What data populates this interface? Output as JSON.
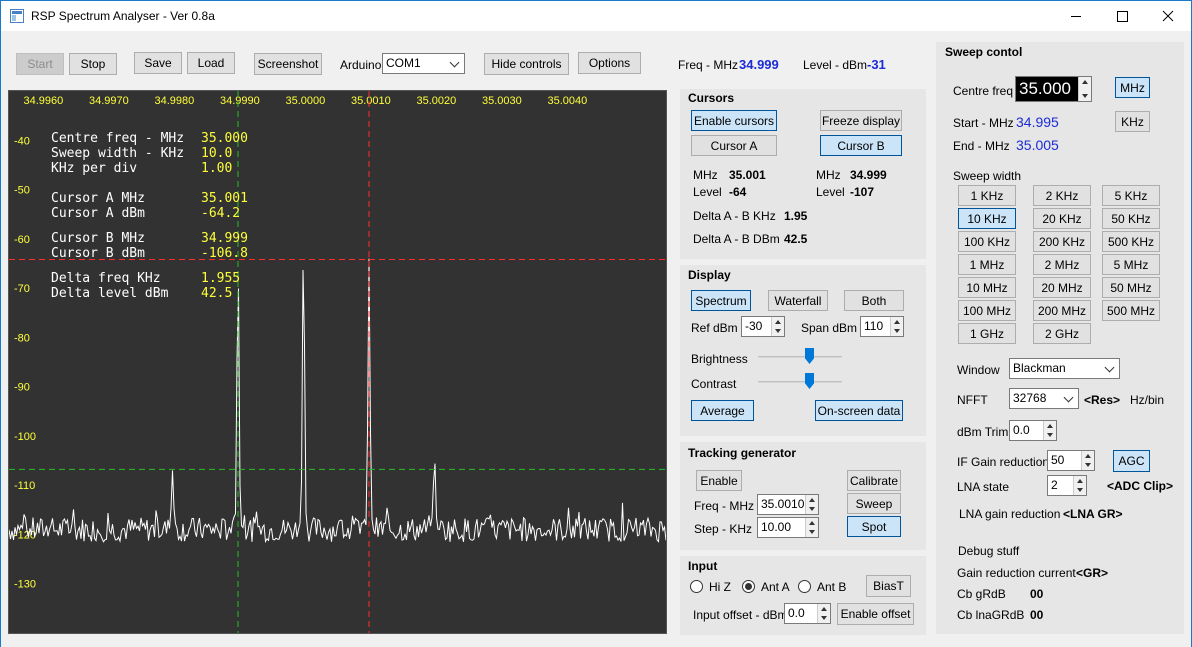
{
  "window": {
    "title": "RSP Spectrum Analyser - Ver 0.8a"
  },
  "toolbar": {
    "start": "Start",
    "stop": "Stop",
    "save": "Save",
    "load": "Load",
    "screenshot": "Screenshot",
    "arduino_label": "Arduino",
    "arduino_port": "COM1",
    "hide_controls": "Hide controls",
    "options": "Options",
    "freq_label": "Freq - MHz",
    "freq_value": "34.999",
    "level_label": "Level - dBm",
    "level_value": "-31"
  },
  "plot": {
    "x_ticks": [
      "34.9960",
      "34.9970",
      "34.9980",
      "34.9990",
      "35.0000",
      "35.0010",
      "35.0020",
      "35.0030",
      "35.0040"
    ],
    "y_ticks": [
      "-40",
      "-50",
      "-60",
      "-70",
      "-80",
      "-90",
      "-100",
      "-110",
      "-120",
      "-130"
    ],
    "overlay": {
      "centre_freq_label": "Centre freq - MHz",
      "centre_freq_value": "35.000",
      "sweep_width_label": "Sweep width - KHz",
      "sweep_width_value": "10.0",
      "khz_per_div_label": "KHz per div",
      "khz_per_div_value": "1.00",
      "cursor_a_mhz_label": "Cursor A MHz",
      "cursor_a_mhz_value": "35.001",
      "cursor_a_dbm_label": "Cursor A dBm",
      "cursor_a_dbm_value": "-64.2",
      "cursor_b_mhz_label": "Cursor B MHz",
      "cursor_b_mhz_value": "34.999",
      "cursor_b_dbm_label": "Cursor B dBm",
      "cursor_b_dbm_value": "-106.8",
      "delta_freq_label": "Delta freq KHz",
      "delta_freq_value": "1.955",
      "delta_level_label": "Delta level dBm",
      "delta_level_value": "42.5"
    },
    "colors": {
      "background": "#323232",
      "cursor_a": "#ff2a2a",
      "cursor_b": "#22c022",
      "trace": "#ffffff",
      "labels": "#ffff3a"
    },
    "trace": {
      "noise_floor_dbm": -119,
      "peaks": [
        {
          "freq_mhz": 34.999,
          "level_dbm": -64.2
        },
        {
          "freq_mhz": 35.0,
          "level_dbm": -60
        },
        {
          "freq_mhz": 35.001,
          "level_dbm": -64
        },
        {
          "freq_mhz": 34.998,
          "level_dbm": -107
        },
        {
          "freq_mhz": 35.002,
          "level_dbm": -104
        }
      ]
    }
  },
  "cursors": {
    "title": "Cursors",
    "enable": "Enable cursors",
    "freeze": "Freeze display",
    "cursor_a": "Cursor A",
    "cursor_b": "Cursor B",
    "mhz_label": "MHz",
    "level_label": "Level",
    "a_mhz": "35.001",
    "a_level": "-64",
    "b_mhz": "34.999",
    "b_level": "-107",
    "delta_khz_label": "Delta A - B KHz",
    "delta_khz": "1.95",
    "delta_db_label": "Delta A - B DBm",
    "delta_db": "42.5"
  },
  "display": {
    "title": "Display",
    "spectrum": "Spectrum",
    "waterfall": "Waterfall",
    "both": "Both",
    "ref_label": "Ref dBm",
    "ref_value": "-30",
    "span_label": "Span dBm",
    "span_value": "110",
    "brightness": "Brightness",
    "contrast": "Contrast",
    "brightness_level": 0.63,
    "contrast_level": 0.63,
    "average": "Average",
    "onscreen": "On-screen data"
  },
  "tracking": {
    "title": "Tracking generator",
    "enable": "Enable",
    "calibrate": "Calibrate",
    "freq_label": "Freq - MHz",
    "freq_value": "35.0010",
    "sweep": "Sweep",
    "step_label": "Step - KHz",
    "step_value": "10.00",
    "spot": "Spot"
  },
  "input": {
    "title": "Input",
    "hiz": "Hi Z",
    "anta": "Ant A",
    "antb": "Ant B",
    "biast": "BiasT",
    "offset_label": "Input offset - dBm",
    "offset_value": "0.0",
    "enable_offset": "Enable offset"
  },
  "sweep": {
    "title": "Sweep contol",
    "centre_label": "Centre freq",
    "centre_value": "35.000",
    "mhz_btn": "MHz",
    "khz_btn": "KHz",
    "start_label": "Start - MHz",
    "start_value": "34.995",
    "end_label": "End - MHz",
    "end_value": "35.005",
    "width_label": "Sweep width",
    "widths": [
      "1 KHz",
      "2 KHz",
      "5 KHz",
      "10 KHz",
      "20 KHz",
      "50 KHz",
      "100 KHz",
      "200 KHz",
      "500 KHz",
      "1 MHz",
      "2 MHz",
      "5 MHz",
      "10 MHz",
      "20 MHz",
      "50 MHz",
      "100 MHz",
      "200 MHz",
      "500 MHz",
      "1 GHz",
      "2 GHz"
    ],
    "window_label": "Window",
    "window_value": "Blackman",
    "nfft_label": "NFFT",
    "nfft_value": "32768",
    "res": "<Res>",
    "hzbin": "Hz/bin",
    "trim_label": "dBm Trim",
    "trim_value": "0.0",
    "ifgain_label": "IF Gain reduction",
    "ifgain_value": "50",
    "agc": "AGC",
    "lna_label": "LNA state",
    "lna_value": "2",
    "adc_clip": "<ADC Clip>",
    "lnagr_label": "LNA gain reduction",
    "lnagr": "<LNA GR>",
    "debug_label": "Debug stuff",
    "grc_label": "Gain reduction current",
    "grc": "<GR>",
    "cbgrdb_label": "Cb gRdB",
    "cbgrdb": "00",
    "cblna_label": "Cb lnaGRdB",
    "cblna": "00"
  }
}
